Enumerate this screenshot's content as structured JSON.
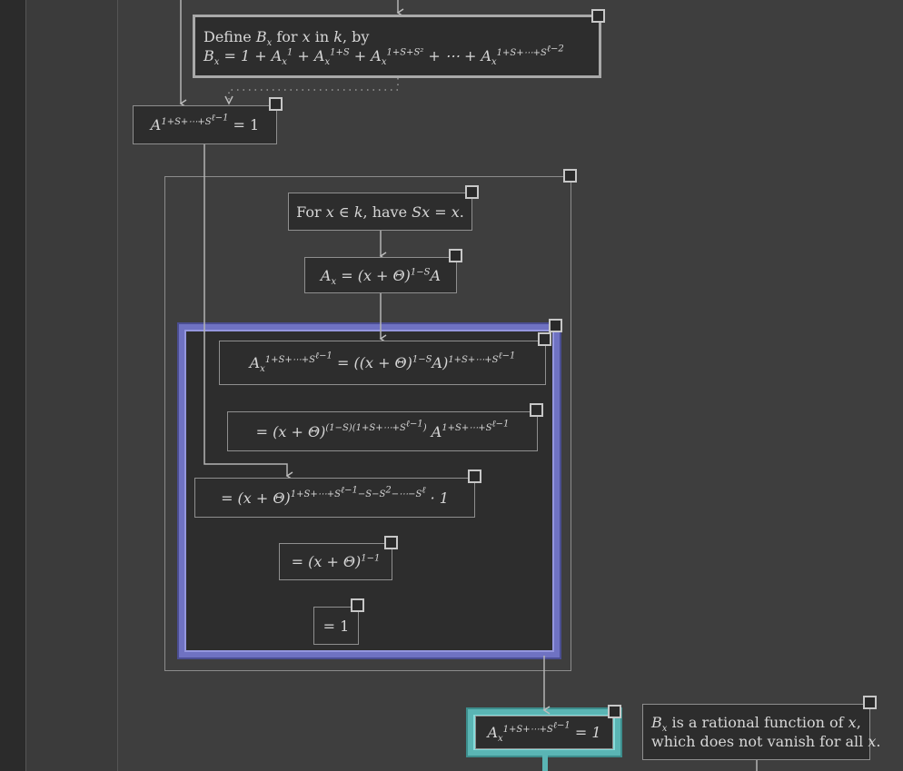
{
  "colors": {
    "background": "#3b3b3b",
    "panel": "#3e3e3e",
    "node_fill": "#2d2d2d",
    "edge": "#b4b4b4",
    "highlight_blue": "#6f72c2",
    "highlight_teal": "#5ab5b4"
  },
  "nodes": {
    "define_bx": {
      "line1_a": "Define ",
      "line1_b": "B",
      "line1_b_sub": "x",
      "line1_c": " for ",
      "line1_d": "x",
      "line1_e": " in ",
      "line1_f": "k",
      "line1_g": ", by",
      "line2": "= 1 + A",
      "line2_terms": "B_x = 1 + A_x^1 + A_x^{1+S} + A_x^{1+S+S^2} + ⋯ + A_x^{1+S+⋯+S^{ℓ−2}}"
    },
    "a_power_one": {
      "base": "A",
      "exp": "1+S+⋯+S",
      "exp2": "ℓ−1",
      "rhs": " = 1"
    },
    "for_x_in_k": {
      "a": "For ",
      "b": "x",
      "c": " ∈ ",
      "d": "k",
      "e": ", have ",
      "f": "Sx",
      "g": " = ",
      "h": "x",
      "i": "."
    },
    "ax_def": {
      "lhs": "A",
      "sub": "x",
      "mid": " = (x + Θ)",
      "exp": "1−S",
      "rhs": "A"
    },
    "step1": {
      "lhs": "A",
      "sub": "x",
      "exp": "1+S+⋯+S",
      "exp2": "ℓ−1",
      "mid": " = ((x + Θ)",
      "exp3": "1−S",
      "tail": "A)",
      "exp4": "1+S+⋯+S",
      "exp5": "ℓ−1"
    },
    "step2": {
      "a": "= (x + Θ)",
      "exp": "(1−S)(1+S+⋯+S",
      "exp2": "ℓ−1",
      "exp3": ")",
      "b": "A",
      "exp4": "1+S+⋯+S",
      "exp5": "ℓ−1"
    },
    "step3": {
      "a": "= (x + Θ)",
      "exp": "1+S+⋯+S",
      "exp2": "ℓ−1",
      "exp3": "−S−S",
      "exp4": "2",
      "exp5": "−⋯−S",
      "exp6": "ℓ",
      "b": " · 1"
    },
    "step4": {
      "a": "= (x + Θ)",
      "exp": "1−1"
    },
    "step5": {
      "a": "= 1"
    },
    "ax_power_one": {
      "base": "A",
      "sub": "x",
      "exp": "1+S+⋯+S",
      "exp2": "ℓ−1",
      "rhs": " = 1"
    },
    "bx_rational": {
      "l1a": "B",
      "l1sub": "x",
      "l1b": " is a rational function of ",
      "l1c": "x",
      "l1d": ",",
      "l2a": "which does not vanish for all ",
      "l2b": "x",
      "l2c": "."
    }
  }
}
